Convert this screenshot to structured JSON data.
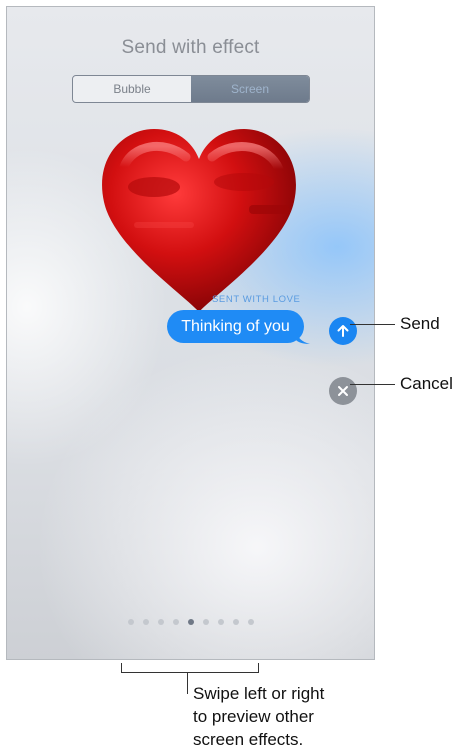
{
  "screen": {
    "title": "Send with effect",
    "tabs": [
      {
        "label": "Bubble",
        "selected": false
      },
      {
        "label": "Screen",
        "selected": true
      }
    ]
  },
  "effect": {
    "label": "SENT WITH LOVE",
    "icon": "heart-icon"
  },
  "message": {
    "text": "Thinking of you",
    "bubble_color": "#1f8bf5"
  },
  "buttons": {
    "send_icon": "arrow-up-icon",
    "cancel_icon": "close-icon"
  },
  "page_indicator": {
    "total": 9,
    "current": 5
  },
  "callouts": {
    "send": "Send",
    "cancel": "Cancel",
    "swipe_lines": [
      "Swipe left or right",
      "to preview other",
      "screen effects."
    ]
  }
}
